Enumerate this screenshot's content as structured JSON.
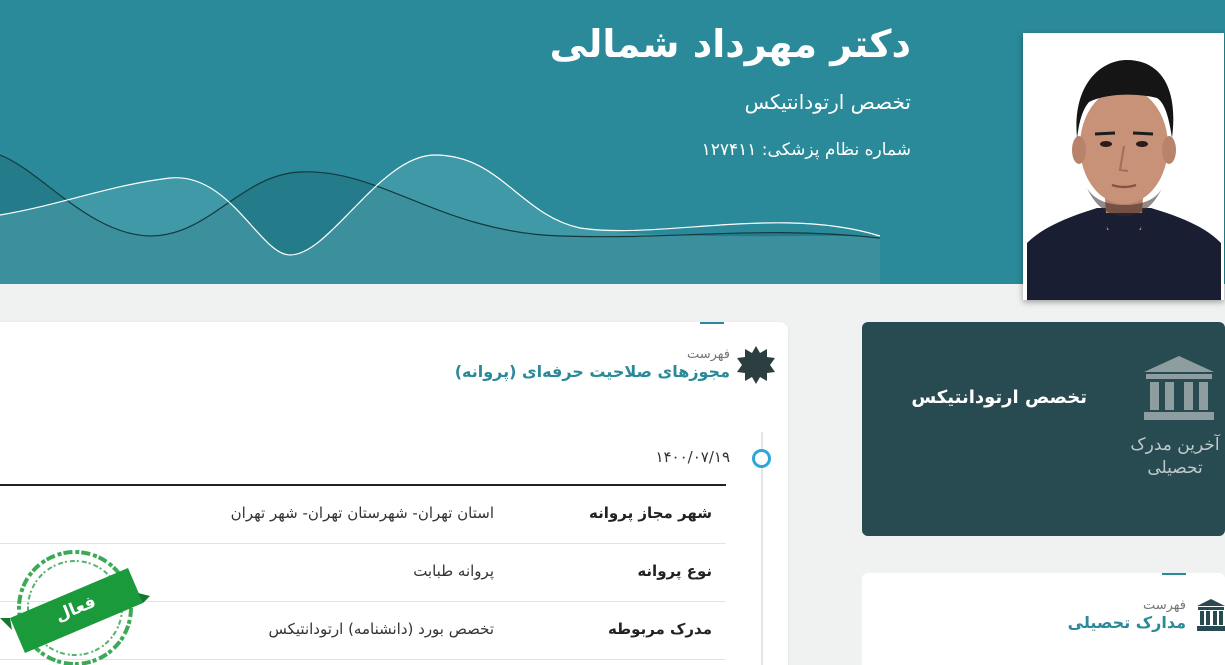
{
  "doctor": {
    "name": "دکتر مهرداد شمالی",
    "specialty": "تخصص ارتودانتیکس",
    "medical_number": "شماره نظام پزشکی: ۱۲۷۴۱۱"
  },
  "licenses": {
    "subtitle": "فهرست",
    "title": "مجوزهای صلاحیت حرفه‌ای (پروانه)",
    "date": "۱۴۰۰/۰۷/۱۹",
    "rows": [
      {
        "label": "شهر مجاز پروانه",
        "value": "استان تهران- شهرستان تهران- شهر تهران"
      },
      {
        "label": "نوع پروانه",
        "value": "پروانه طبابت"
      },
      {
        "label": "مدرک مربوطه",
        "value": "تخصص بورد (دانشنامه) ارتودانتیکس"
      }
    ],
    "status_stamp": "فعال",
    "status_color": "#1a9a3a"
  },
  "education_card": {
    "specialty": "تخصص ارتودانتیکس",
    "caption": "آخرین مدرک تحصیلی"
  },
  "education_list": {
    "subtitle": "فهرست",
    "title": "مدارک تحصیلی"
  },
  "colors": {
    "header": "#2a8a99",
    "dark_card": "#284b51",
    "accent": "#2a8a99"
  }
}
